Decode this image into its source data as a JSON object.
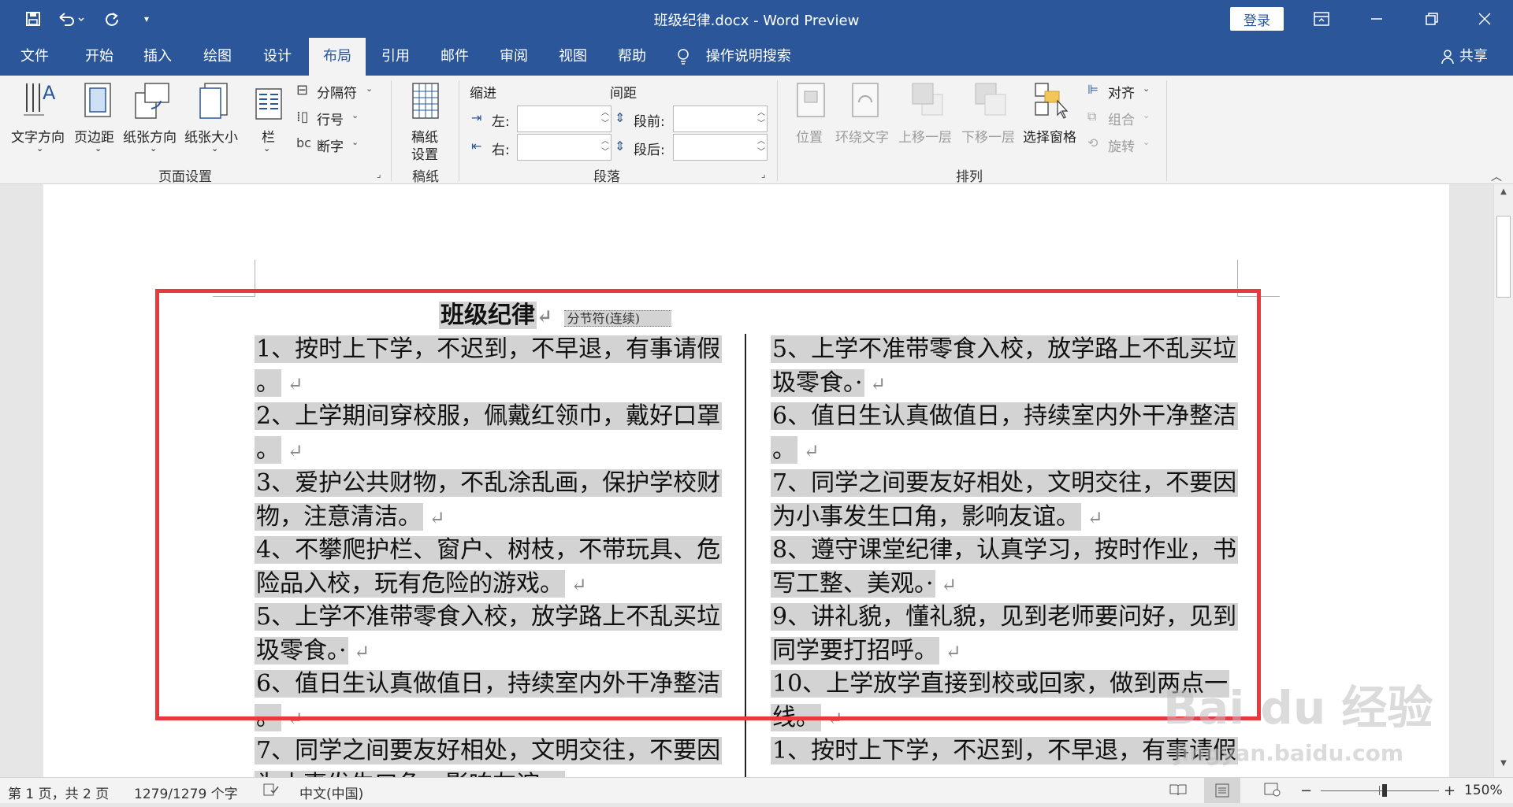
{
  "window": {
    "title": "班级纪律.docx  -  Word Preview",
    "login_label": "登录"
  },
  "tabs": [
    "文件",
    "开始",
    "插入",
    "绘图",
    "设计",
    "布局",
    "引用",
    "邮件",
    "审阅",
    "视图",
    "帮助"
  ],
  "active_tab": "布局",
  "search_label": "操作说明搜索",
  "share_label": "共享",
  "ribbon": {
    "page_setup": {
      "text_direction": "文字方向",
      "margins": "页边距",
      "orientation": "纸张方向",
      "size": "纸张大小",
      "columns": "栏",
      "breaks": "分隔符",
      "line_numbers": "行号",
      "hyphenation": "断字",
      "group_label": "页面设置"
    },
    "manuscript": {
      "button": "稿纸\n设置",
      "button_line1": "稿纸",
      "button_line2": "设置",
      "group_label": "稿纸"
    },
    "paragraph": {
      "indent_label": "缩进",
      "spacing_label": "间距",
      "left_label": "左:",
      "right_label": "右:",
      "before_label": "段前:",
      "after_label": "段后:",
      "group_label": "段落"
    },
    "arrange": {
      "position": "位置",
      "wrap_text": "环绕文字",
      "bring_forward": "上移一层",
      "send_backward": "下移一层",
      "selection_pane": "选择窗格",
      "align": "对齐",
      "group": "组合",
      "rotate": "旋转",
      "group_label": "排列"
    }
  },
  "document": {
    "title": "班级纪律",
    "section_break": "分节符(连续)",
    "left_column": [
      "1、按时上下学，不迟到，不早退，有事请假",
      "。",
      "2、上学期间穿校服，佩戴红领巾，戴好口罩",
      "。",
      "3、爱护公共财物，不乱涂乱画，保护学校财",
      "物，注意清洁。",
      "4、不攀爬护栏、窗户、树枝，不带玩具、危",
      "险品入校，玩有危险的游戏。",
      "5、上学不准带零食入校，放学路上不乱买垃",
      "圾零食。·",
      "6、值日生认真做值日，持续室内外干净整洁",
      "。",
      "7、同学之间要友好相处，文明交往，不要因",
      "为小事发生口角，影响友谊。"
    ],
    "right_column": [
      "5、上学不准带零食入校，放学路上不乱买垃",
      "圾零食。·",
      "6、值日生认真做值日，持续室内外干净整洁",
      "。",
      "7、同学之间要友好相处，文明交往，不要因",
      "为小事发生口角，影响友谊。",
      "8、遵守课堂纪律，认真学习，按时作业，书",
      "写工整、美观。·",
      "9、讲礼貌，懂礼貌，见到老师要问好，见到",
      "同学要打招呼。",
      "10、上学放学直接到校或回家，做到两点一",
      "线。",
      "1、按时上下学，不迟到，不早退，有事请假",
      ""
    ],
    "paragraph_mark": "↵"
  },
  "status": {
    "page": "第 1 页，共 2 页",
    "words": "1279/1279 个字",
    "language": "中文(中国)",
    "zoom": "150%"
  },
  "watermark": {
    "brand": "Bai du 经验",
    "url": "jingyan.baidu.com"
  },
  "colors": {
    "accent": "#2b579a",
    "highlight": "#d3d3d3",
    "annotation": "#e8393d"
  }
}
